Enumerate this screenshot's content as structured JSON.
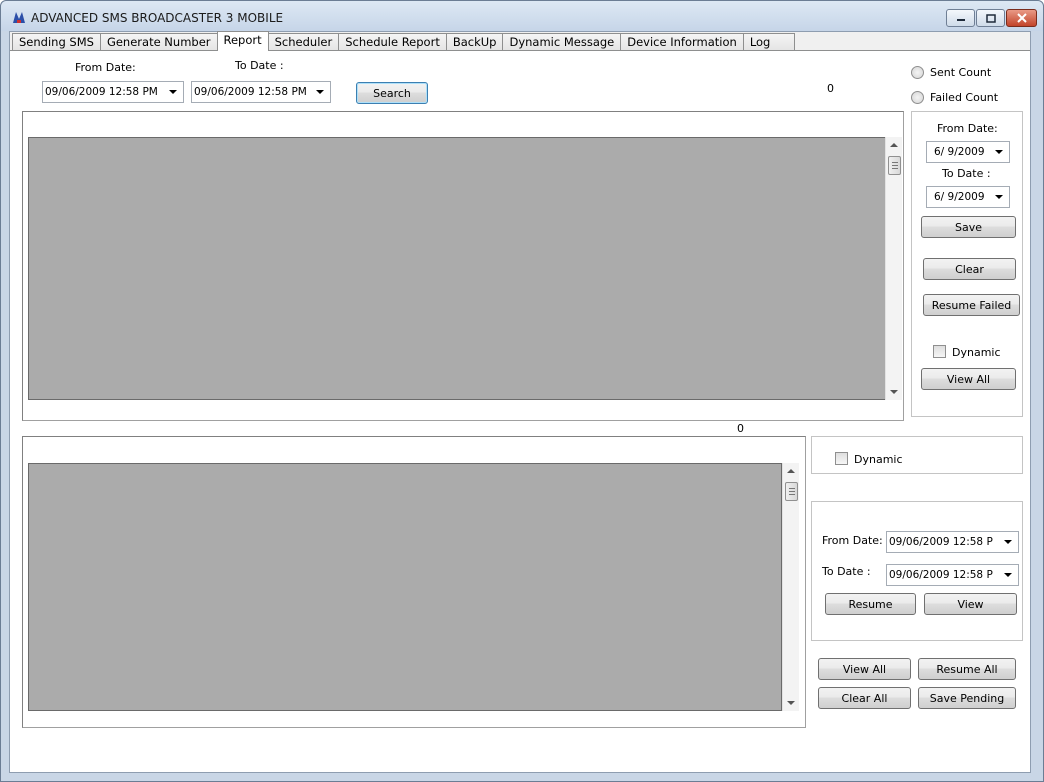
{
  "window": {
    "title": "ADVANCED SMS BROADCASTER 3 MOBILE"
  },
  "tabs": [
    {
      "label": "Sending SMS"
    },
    {
      "label": "Generate Number"
    },
    {
      "label": "Report"
    },
    {
      "label": "Scheduler"
    },
    {
      "label": "Schedule Report"
    },
    {
      "label": "BackUp"
    },
    {
      "label": "Dynamic Message"
    },
    {
      "label": "Device Information"
    },
    {
      "label": "Log"
    }
  ],
  "active_tab": "Report",
  "search": {
    "from_label": "From Date:",
    "to_label": "To Date :",
    "from_value": "09/06/2009 12:58 PM",
    "to_value": "09/06/2009 12:58 PM",
    "button": "Search",
    "result_count": "0"
  },
  "count_options": {
    "sent": "Sent Count",
    "failed": "Failed Count"
  },
  "right_panel": {
    "from_label": "From Date:",
    "from_value": "6/  9/2009",
    "to_label": "To Date :",
    "to_value": "6/  9/2009",
    "save": "Save",
    "clear": "Clear",
    "resume_failed": "Resume Failed",
    "dynamic_label": "Dynamic",
    "view_all": "View All"
  },
  "lower": {
    "count": "0",
    "dynamic_label": "Dynamic",
    "from_label": "From Date:",
    "from_value": "09/06/2009 12:58 P",
    "to_label": "To Date :",
    "to_value": "09/06/2009 12:58 P",
    "resume": "Resume",
    "view": "View",
    "view_all": "View All",
    "resume_all": "Resume All",
    "clear_all": "Clear All",
    "save_pending": "Save Pending"
  },
  "colors": {
    "grid_bg": "#ababab",
    "titlebar": "#c6d5e8",
    "close_button": "#c2442a"
  }
}
